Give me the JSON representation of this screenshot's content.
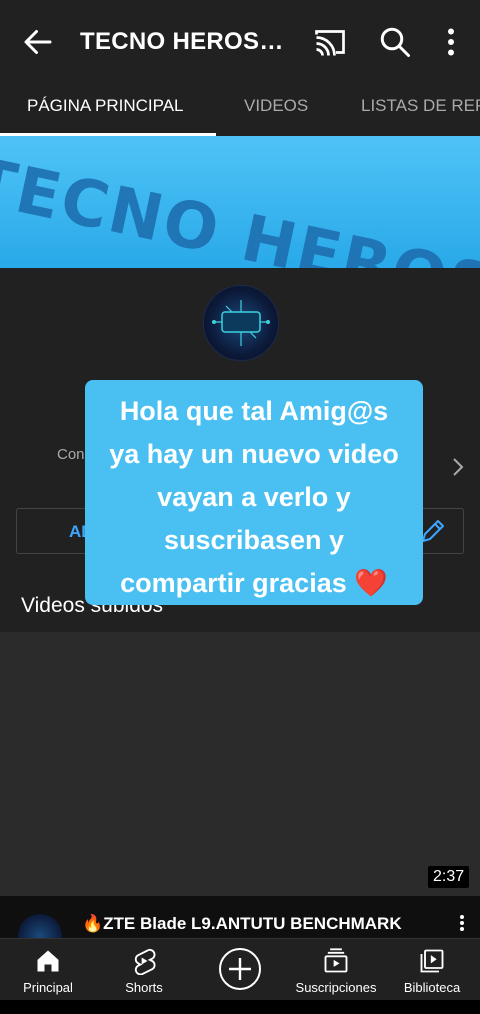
{
  "header": {
    "title": "TECNO HEROS SHOW"
  },
  "tabs": [
    {
      "label": "PÁGINA PRINCIPAL"
    },
    {
      "label": "VIDEOS"
    },
    {
      "label": "LISTAS DE REPRODUCCIÓN"
    }
  ],
  "banner": {
    "text": "TECNO HEROS SHOW"
  },
  "channel": {
    "stats_text": "Con",
    "admin_button_label": "ADMINIS"
  },
  "overlay": {
    "lines": [
      "Hola que tal Amig@s",
      "ya hay un nuevo video",
      "vayan a verlo y",
      "suscribasen y",
      "compartir gracias ❤️"
    ]
  },
  "section": {
    "title": "Videos subidos"
  },
  "video": {
    "duration": "2:37",
    "title": "🔥ZTE Blade L9.ANTUTU BENCHMARK"
  },
  "bottom_nav": [
    {
      "label": "Principal",
      "icon": "home-icon"
    },
    {
      "label": "Shorts",
      "icon": "shorts-icon"
    },
    {
      "label": "",
      "icon": "add-icon"
    },
    {
      "label": "Suscripciones",
      "icon": "subscriptions-icon"
    },
    {
      "label": "Biblioteca",
      "icon": "library-icon"
    }
  ],
  "colors": {
    "accent_blue": "#3ea6ff",
    "overlay_bg": "#4ac0f2",
    "banner_bg": "#4fc3f7"
  }
}
